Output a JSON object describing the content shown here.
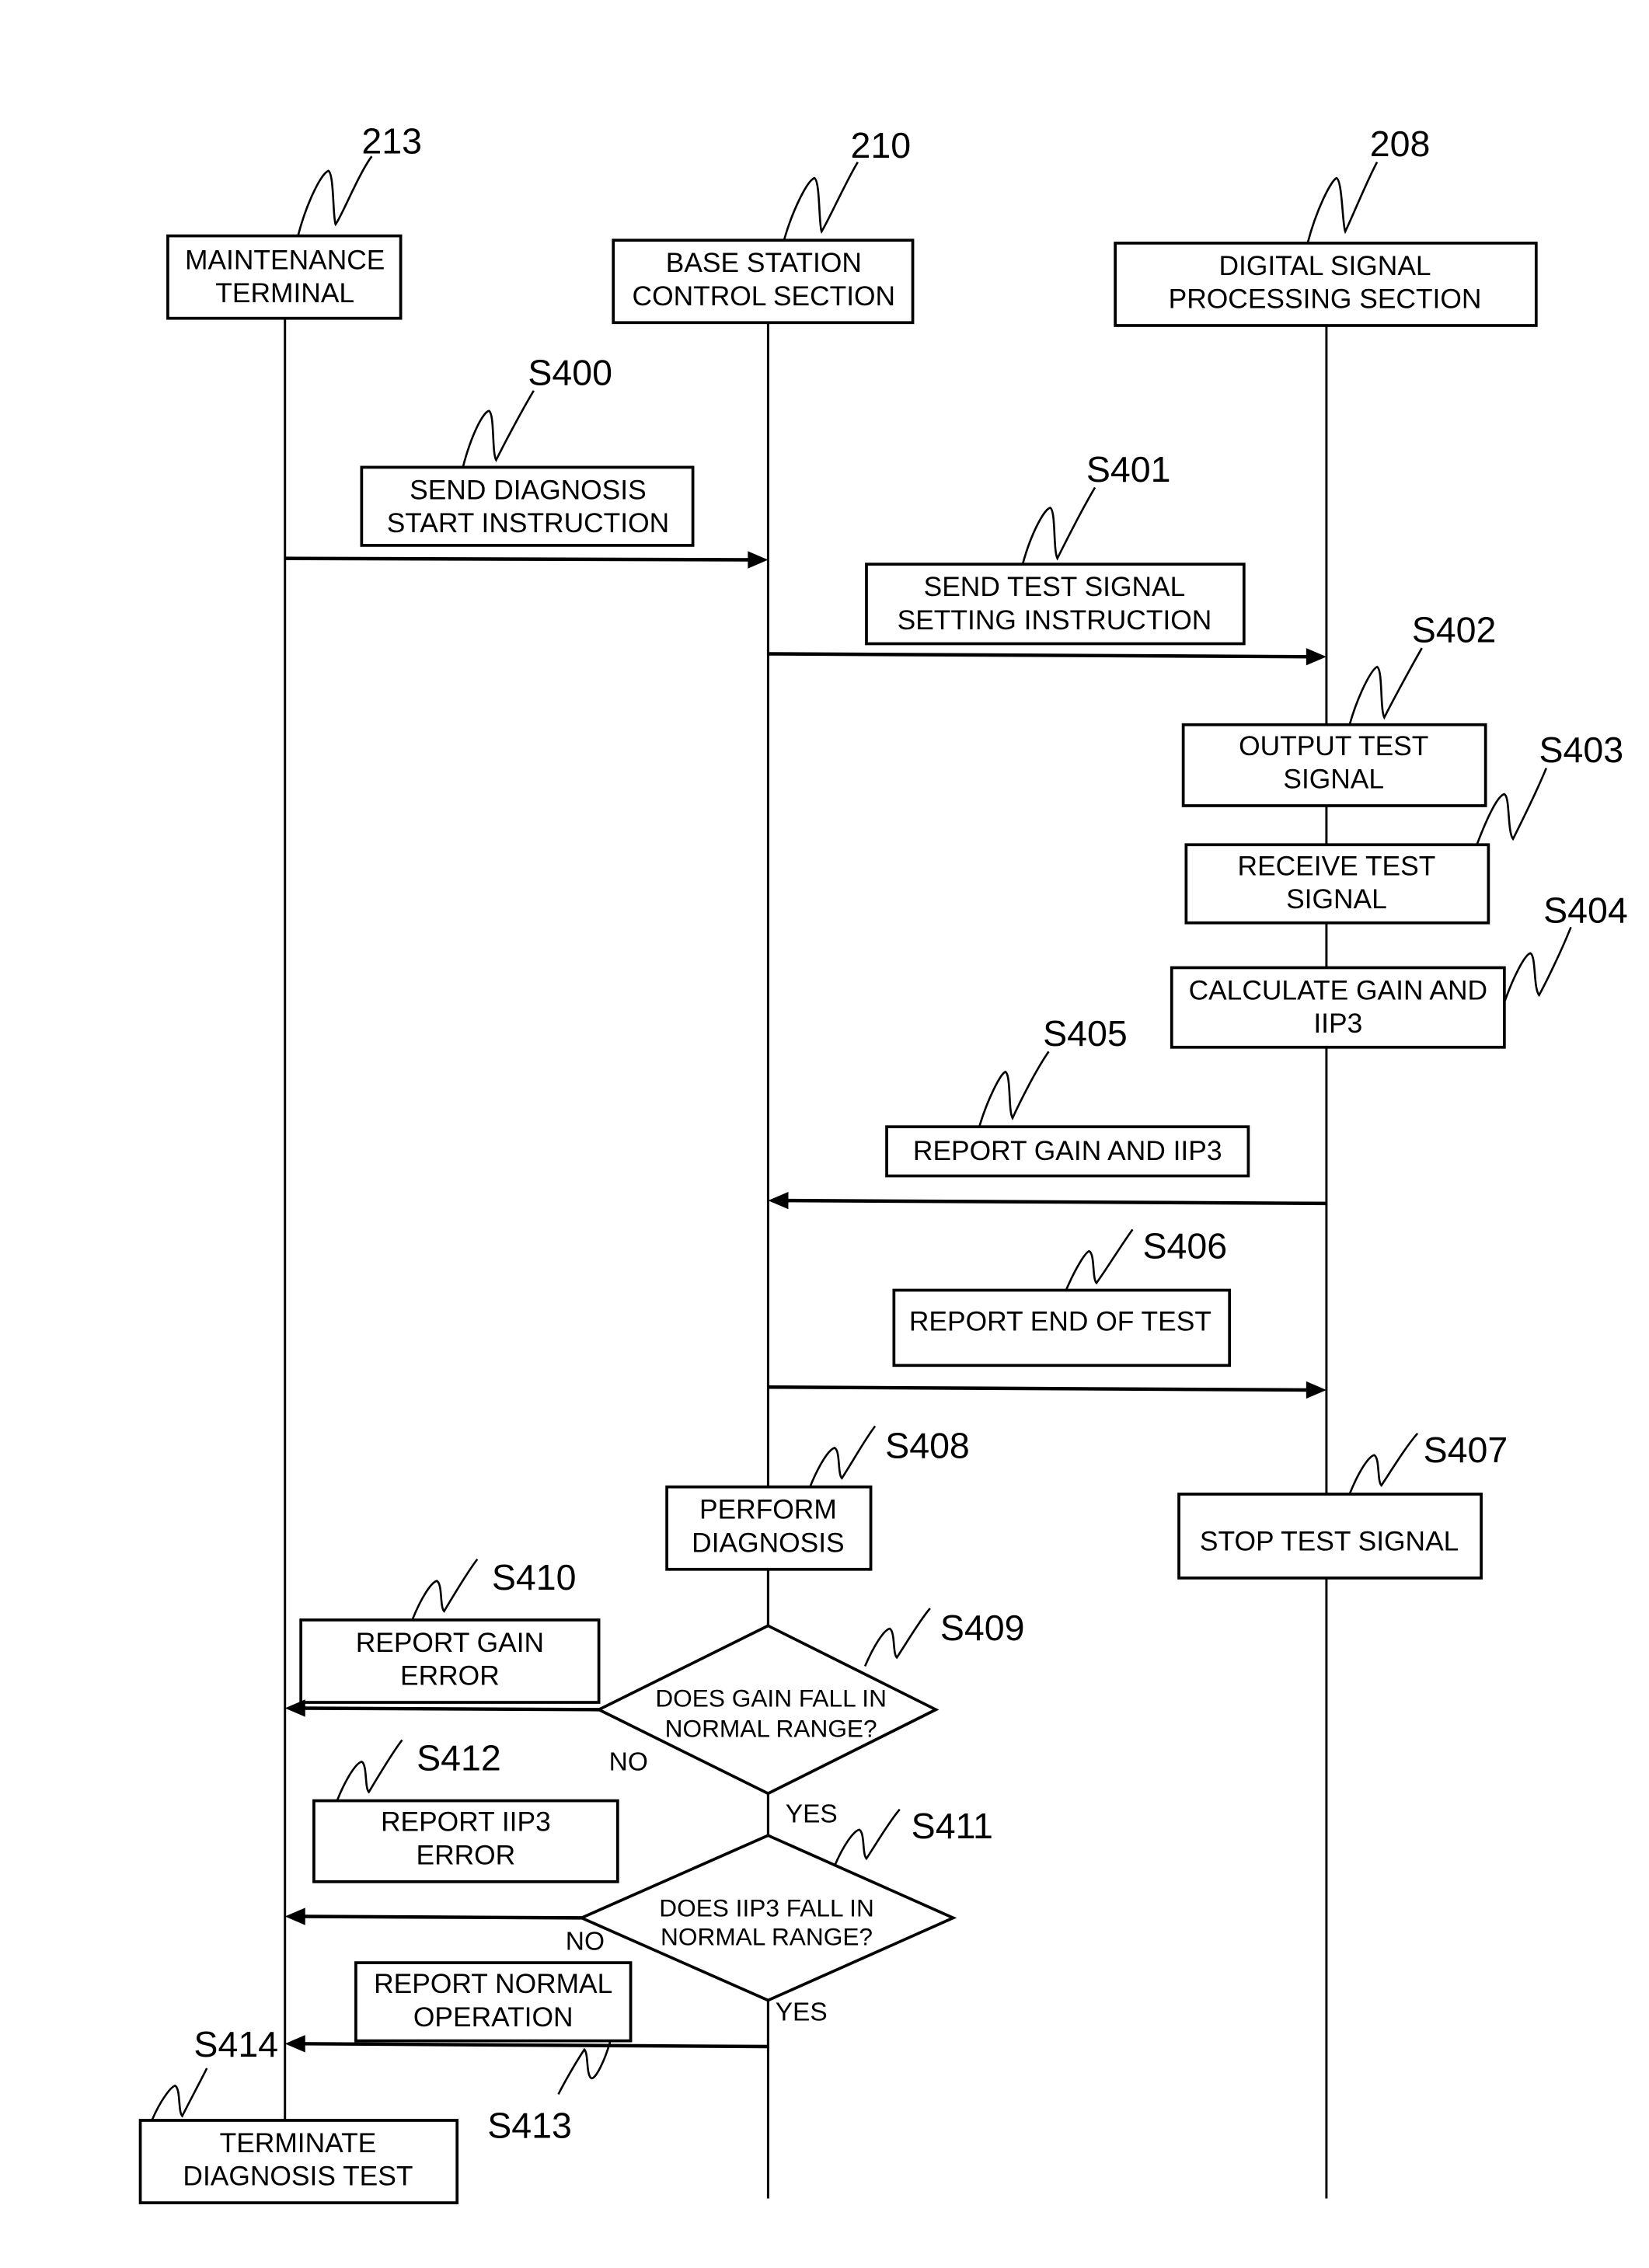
{
  "diagram": {
    "lifelines": [
      {
        "ref": "213",
        "label_line1": "MAINTENANCE",
        "label_line2": "TERMINAL"
      },
      {
        "ref": "210",
        "label_line1": "BASE STATION",
        "label_line2": "CONTROL SECTION"
      },
      {
        "ref": "208",
        "label_line1": "DIGITAL SIGNAL",
        "label_line2": "PROCESSING SECTION"
      }
    ],
    "steps": {
      "s400": {
        "ref": "S400",
        "line1": "SEND DIAGNOSIS",
        "line2": "START INSTRUCTION"
      },
      "s401": {
        "ref": "S401",
        "line1": "SEND TEST SIGNAL",
        "line2": "SETTING INSTRUCTION"
      },
      "s402": {
        "ref": "S402",
        "line1": "OUTPUT TEST",
        "line2": "SIGNAL"
      },
      "s403": {
        "ref": "S403",
        "line1": "RECEIVE TEST",
        "line2": "SIGNAL"
      },
      "s404": {
        "ref": "S404",
        "line1": "CALCULATE GAIN AND",
        "line2": "IIP3"
      },
      "s405": {
        "ref": "S405",
        "line1": "REPORT GAIN AND IIP3"
      },
      "s406": {
        "ref": "S406",
        "line1": "REPORT END OF TEST"
      },
      "s407": {
        "ref": "S407",
        "line1": "STOP TEST SIGNAL"
      },
      "s408": {
        "ref": "S408",
        "line1": "PERFORM",
        "line2": "DIAGNOSIS"
      },
      "s409": {
        "ref": "S409",
        "line1": "DOES GAIN FALL IN",
        "line2": "NORMAL RANGE?",
        "no": "NO",
        "yes": "YES"
      },
      "s410": {
        "ref": "S410",
        "line1": "REPORT GAIN",
        "line2": "ERROR"
      },
      "s411": {
        "ref": "S411",
        "line1": "DOES IIP3 FALL IN",
        "line2": "NORMAL RANGE?",
        "no": "NO",
        "yes": "YES"
      },
      "s412": {
        "ref": "S412",
        "line1": "REPORT IIP3",
        "line2": "ERROR"
      },
      "s413": {
        "ref": "S413",
        "line1": "REPORT NORMAL",
        "line2": "OPERATION"
      },
      "s414": {
        "ref": "S414",
        "line1": "TERMINATE",
        "line2": "DIAGNOSIS TEST"
      }
    }
  }
}
